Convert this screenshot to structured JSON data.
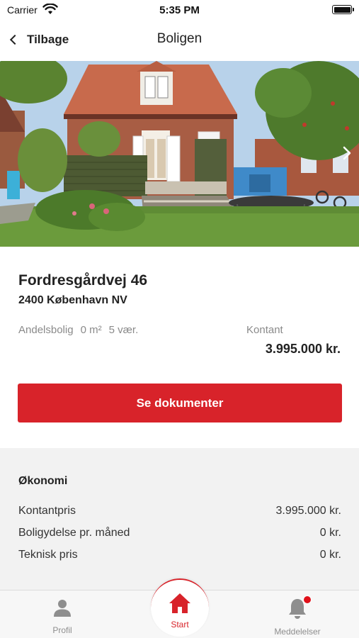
{
  "status_bar": {
    "carrier": "Carrier",
    "time": "5:35 PM",
    "icons": [
      "wifi-icon",
      "battery-icon"
    ]
  },
  "nav": {
    "back_label": "Tilbage",
    "title": "Boligen",
    "back_icon": "chevron-left-icon"
  },
  "hero": {
    "image": "house-photo",
    "next_icon": "chevron-right-icon"
  },
  "property": {
    "address": "Fordresgårdvej 46",
    "city": "2400 København NV",
    "type": "Andelsbolig",
    "area": "0 m²",
    "rooms": "5 vær.",
    "price_label": "Kontant",
    "price": "3.995.000 kr."
  },
  "docs_button": {
    "label": "Se dokumenter"
  },
  "economy": {
    "title": "Økonomi",
    "rows": [
      {
        "label": "Kontantpris",
        "value": "3.995.000 kr."
      },
      {
        "label": "Boligydelse pr. måned",
        "value": "0 kr."
      },
      {
        "label": "Teknisk pris",
        "value": "0 kr."
      }
    ]
  },
  "tabs": {
    "profile": "Profil",
    "start": "Start",
    "messages": "Meddelelser"
  },
  "colors": {
    "accent": "#d8232a",
    "tab_inactive": "#8e8e8e",
    "section_bg": "#f2f2f2"
  }
}
